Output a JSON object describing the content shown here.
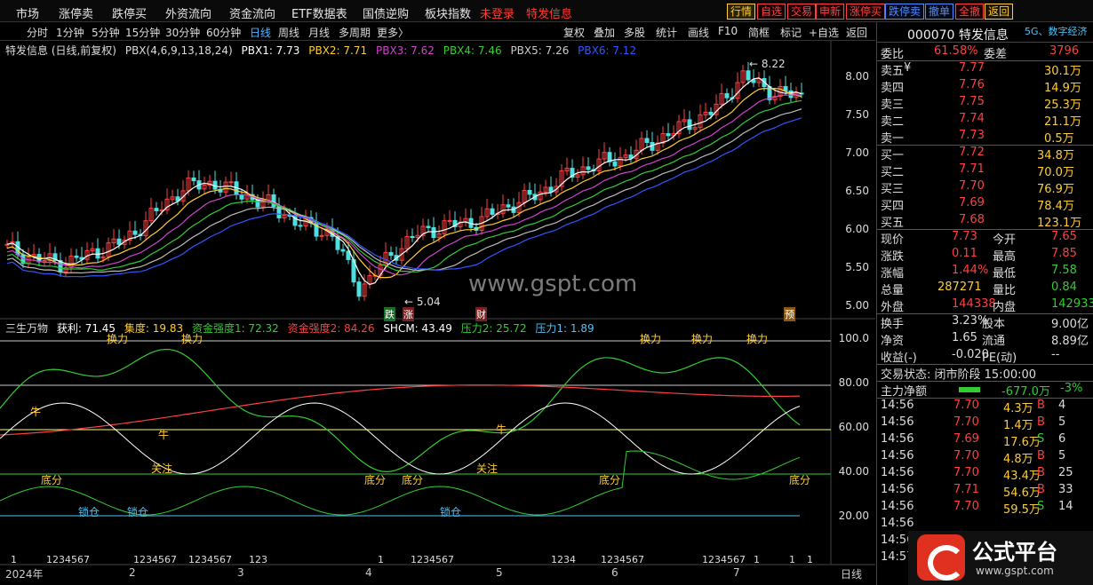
{
  "menu": [
    "市场",
    "涨停卖",
    "跌停买",
    "外资流向",
    "资金流向",
    "ETF数据表",
    "国债逆购",
    "板块指数",
    "未登录",
    "特发信息"
  ],
  "toolbar": [
    "行情",
    "自选",
    "交易",
    "申新",
    "涨停买",
    "跌停卖",
    "撤单",
    "全撤",
    "返回"
  ],
  "periods": [
    "分时",
    "1分钟",
    "5分钟",
    "15分钟",
    "30分钟",
    "60分钟",
    "日线",
    "周线",
    "月线",
    "多周期",
    "更多〉"
  ],
  "tools": [
    "复权",
    "叠加",
    "多股",
    "统计",
    "画线",
    "F10",
    "简框",
    "标记",
    "+自选",
    "返回"
  ],
  "main": {
    "title": "特发信息 (日线,前复权)",
    "ind": "PBX(4,6,9,13,18,24)",
    "pbx": [
      "PBX1: 7.73",
      "PBX2: 7.71",
      "PBX3: 7.62",
      "PBX4: 7.46",
      "PBX5: 7.26",
      "PBX6: 7.12"
    ],
    "y": [
      "8.00",
      "7.50",
      "7.00",
      "6.50",
      "6.00",
      "5.50",
      "5.00"
    ],
    "hi": "8.22",
    "lo": "5.04",
    "marks": [
      "跌",
      "涨",
      "财",
      "预"
    ]
  },
  "sub": {
    "name": "三生万物",
    "vals": [
      "获利: 71.45",
      "集度: 19.83",
      "资金强度1: 72.32",
      "资金强度2: 84.26",
      "SHCM: 43.49",
      "压力2: 25.72",
      "压力1: 1.89"
    ],
    "y": [
      "100.0",
      "80.00",
      "60.00",
      "40.00",
      "20.00"
    ],
    "labels": [
      "牛",
      "牛",
      "牛",
      "关注",
      "关注",
      "底分",
      "底分",
      "底分",
      "底分",
      "底分",
      "锁仓",
      "锁仓",
      "锁仓",
      "换力",
      "换力",
      "换力",
      "换力",
      "换力"
    ],
    "counts": [
      "1",
      "1234567",
      "1234567",
      "1234567",
      "123",
      "1",
      "1234567",
      "1234",
      "1234567",
      "1234567",
      "1",
      "1",
      "1"
    ]
  },
  "xaxis": [
    "2024年",
    "2",
    "3",
    "4",
    "5",
    "6",
    "7",
    "日线"
  ],
  "watermark": "www.gspt.com",
  "panel": {
    "code": "000070 特发信息",
    "tag": "5G、数字经济",
    "weibi": [
      "委比",
      "61.58%",
      "委差",
      "3796"
    ],
    "asks": [
      [
        "卖五",
        "¥",
        "7.77",
        "30.1万"
      ],
      [
        "卖四",
        "",
        "7.76",
        "14.9万"
      ],
      [
        "卖三",
        "",
        "7.75",
        "25.3万"
      ],
      [
        "卖二",
        "",
        "7.74",
        "21.1万"
      ],
      [
        "卖一",
        "",
        "7.73",
        "0.5万"
      ]
    ],
    "bids": [
      [
        "买一",
        "7.72",
        "34.8万"
      ],
      [
        "买二",
        "7.71",
        "70.0万"
      ],
      [
        "买三",
        "7.70",
        "76.9万"
      ],
      [
        "买四",
        "7.69",
        "78.4万"
      ],
      [
        "买五",
        "7.68",
        "123.1万"
      ]
    ],
    "quote": [
      [
        "现价",
        "7.73",
        "今开",
        "7.65"
      ],
      [
        "涨跌",
        "0.11",
        "最高",
        "7.85"
      ],
      [
        "涨幅",
        "1.44%",
        "最低",
        "7.58"
      ],
      [
        "总量",
        "287271",
        "量比",
        "0.84"
      ],
      [
        "外盘",
        "144338",
        "内盘",
        "142933"
      ]
    ],
    "stats": [
      [
        "换手",
        "3.23%",
        "股本",
        "9.00亿"
      ],
      [
        "净资",
        "1.65",
        "流通",
        "8.89亿"
      ],
      [
        "收益(-)",
        "-0.020",
        "PE(动)",
        "--"
      ]
    ],
    "state": "交易状态: 闭市阶段 15:00:00",
    "flow": [
      "主力净额",
      "-677.0万",
      "-3%"
    ],
    "ticks": [
      [
        "14:56",
        "7.70",
        "4.3万",
        "B",
        "4"
      ],
      [
        "14:56",
        "7.70",
        "1.4万",
        "B",
        "5"
      ],
      [
        "14:56",
        "7.69",
        "17.6万",
        "S",
        "6"
      ],
      [
        "14:56",
        "7.70",
        "4.8万",
        "B",
        "5"
      ],
      [
        "14:56",
        "7.70",
        "43.4万",
        "B",
        "25"
      ],
      [
        "14:56",
        "7.71",
        "54.6万",
        "B",
        "33"
      ],
      [
        "14:56",
        "7.70",
        "59.5万",
        "S",
        "14"
      ],
      [
        "14:56",
        "",
        "",
        " ",
        ""
      ],
      [
        "14:56",
        "",
        "",
        " ",
        ""
      ],
      [
        "14:57",
        "",
        "",
        " ",
        ""
      ]
    ]
  },
  "logo": {
    "t1": "公式平台",
    "t2": "www.gspt.com"
  },
  "colors": {
    "up": "#ff4040",
    "down": "#33cc33",
    "pbx1": "#ffffff",
    "pbx2": "#ffcc33",
    "pbx3": "#cc44cc",
    "pbx4": "#33cc33",
    "pbx5": "#bbbbbb",
    "pbx6": "#3355ff"
  },
  "chart_data": {
    "type": "line",
    "ylim": [
      5.0,
      8.22
    ],
    "series": [
      {
        "name": "PBX1",
        "values": [
          5.75,
          5.6,
          5.55,
          5.7,
          5.85,
          6.2,
          6.55,
          6.6,
          6.45,
          6.3,
          6.05,
          5.95,
          5.2,
          5.65,
          5.95,
          6.05,
          6.1,
          6.3,
          6.45,
          6.7,
          6.85,
          6.95,
          7.15,
          7.35,
          7.55,
          8.0,
          7.8,
          7.73
        ]
      }
    ]
  }
}
